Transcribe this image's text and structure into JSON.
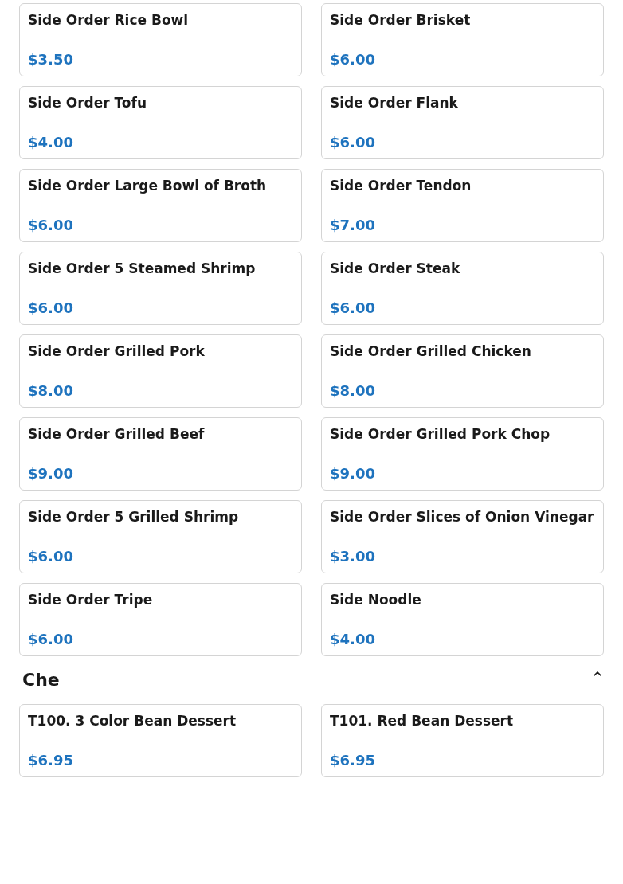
{
  "sections": [
    {
      "items": [
        {
          "name": "Side Order Rice Bowl",
          "price": "$3.50"
        },
        {
          "name": "Side Order Brisket",
          "price": "$6.00"
        },
        {
          "name": "Side Order Tofu",
          "price": "$4.00"
        },
        {
          "name": "Side Order Flank",
          "price": "$6.00"
        },
        {
          "name": "Side Order Large Bowl of Broth",
          "price": "$6.00"
        },
        {
          "name": "Side Order Tendon",
          "price": "$7.00"
        },
        {
          "name": "Side Order 5 Steamed Shrimp",
          "price": "$6.00"
        },
        {
          "name": "Side Order Steak",
          "price": "$6.00"
        },
        {
          "name": "Side Order Grilled Pork",
          "price": "$8.00"
        },
        {
          "name": "Side Order Grilled Chicken",
          "price": "$8.00"
        },
        {
          "name": "Side Order Grilled Beef",
          "price": "$9.00"
        },
        {
          "name": "Side Order Grilled Pork Chop",
          "price": "$9.00"
        },
        {
          "name": "Side Order 5 Grilled Shrimp",
          "price": "$6.00"
        },
        {
          "name": "Side Order Slices of Onion Vinegar",
          "price": "$3.00"
        },
        {
          "name": "Side Order Tripe",
          "price": "$6.00"
        },
        {
          "name": "Side Noodle",
          "price": "$4.00"
        }
      ]
    },
    {
      "title": "Che",
      "expanded": true,
      "items": [
        {
          "name": "T100. 3 Color Bean Dessert",
          "price": "$6.95"
        },
        {
          "name": "T101. Red Bean Dessert",
          "price": "$6.95"
        }
      ]
    }
  ]
}
